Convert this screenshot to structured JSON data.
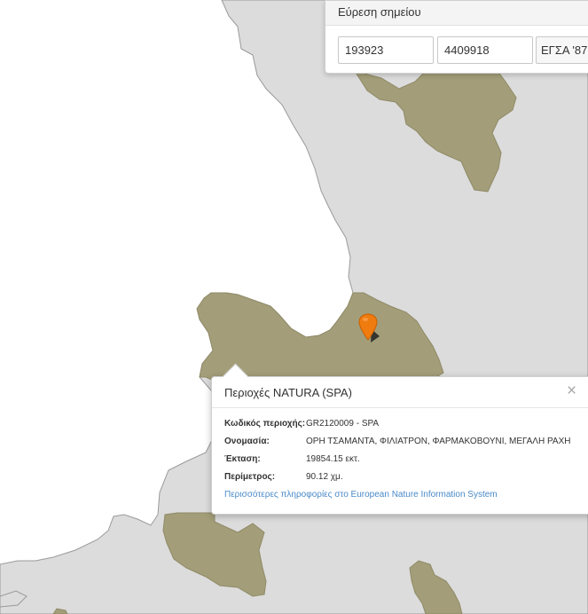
{
  "find_point": {
    "title": "Εύρεση σημείου",
    "x_value": "193923",
    "y_value": "4409918",
    "crs_selected": "ΕΓΣΑ '87"
  },
  "marker": {
    "icon": "map-pin-icon",
    "color": "#f07b0f"
  },
  "popup": {
    "title": "Περιοχές NATURA (SPA)",
    "close_glyph": "×",
    "fields": [
      {
        "label": "Κωδικός περιοχής:",
        "value": "GR2120009 - SPA"
      },
      {
        "label": "Ονομασία:",
        "value": "ΟΡΗ ΤΣΑΜΑΝΤΑ, ΦΙΛΙΑΤΡΟΝ, ΦΑΡΜΑΚΟΒΟΥΝΙ, ΜΕΓΑΛΗ ΡΑΧΗ"
      },
      {
        "label": "Έκταση:",
        "value": "19854.15 εκτ."
      },
      {
        "label": "Περίμετρος:",
        "value": "90.12 χμ."
      }
    ],
    "more_link": "Περισσότερες πληροφορίες στο European Nature Information System"
  },
  "colors": {
    "land": "#dcdcdc",
    "sea": "#ffffff",
    "natura": "#a39e79",
    "border": "#8c8c8c",
    "link": "#4a8ac8"
  }
}
